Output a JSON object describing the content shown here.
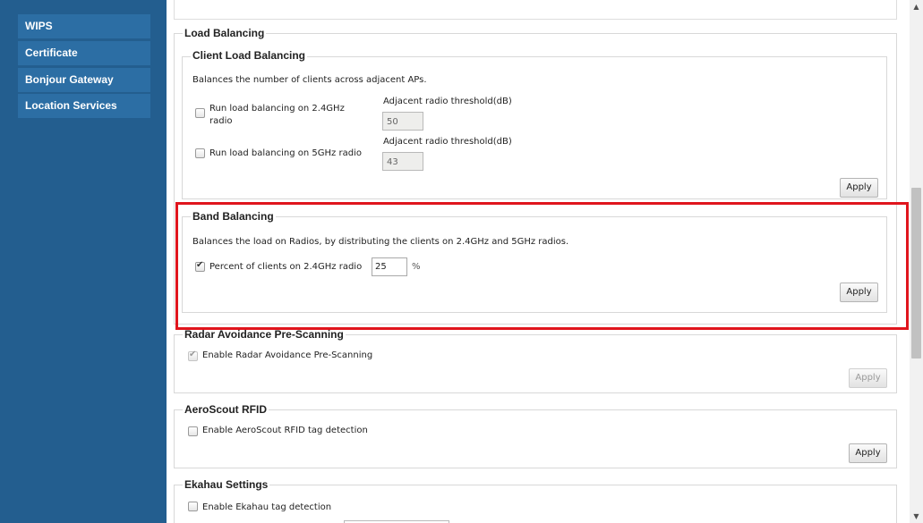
{
  "sidebar": {
    "items": [
      {
        "label": "WIPS"
      },
      {
        "label": "Certificate"
      },
      {
        "label": "Bonjour Gateway"
      },
      {
        "label": "Location Services"
      }
    ]
  },
  "load_balancing": {
    "title": "Load Balancing",
    "client": {
      "title": "Client Load Balancing",
      "description": "Balances the number of clients across adjacent APs.",
      "radio24_label_line1": "Run load balancing on 2.4GHz",
      "radio24_label_line2": "radio",
      "radio24_checked": false,
      "threshold24_label": "Adjacent radio threshold(dB)",
      "threshold24_value": "50",
      "radio5_label": "Run load balancing on 5GHz radio",
      "radio5_checked": false,
      "threshold5_label": "Adjacent radio threshold(dB)",
      "threshold5_value": "43",
      "apply_label": "Apply"
    },
    "band": {
      "title": "Band Balancing",
      "description": "Balances the load on Radios, by distributing the clients on 2.4GHz and 5GHz radios.",
      "percent_label": "Percent of clients on 2.4GHz radio",
      "percent_checked": true,
      "percent_value": "25",
      "percent_unit": "%",
      "apply_label": "Apply"
    }
  },
  "radar": {
    "title": "Radar Avoidance Pre-Scanning",
    "enable_label": "Enable Radar Avoidance Pre-Scanning",
    "enable_checked": true,
    "apply_label": "Apply"
  },
  "aeroscout": {
    "title": "AeroScout RFID",
    "enable_label": "Enable AeroScout RFID tag detection",
    "enable_checked": false,
    "apply_label": "Apply"
  },
  "ekahau": {
    "title": "Ekahau Settings",
    "enable_label": "Enable Ekahau tag detection",
    "enable_checked": false
  },
  "colors": {
    "sidebar_bg": "#235e8f",
    "sidebar_item_bg": "#2c6ea4",
    "highlight": "#e0151d"
  }
}
